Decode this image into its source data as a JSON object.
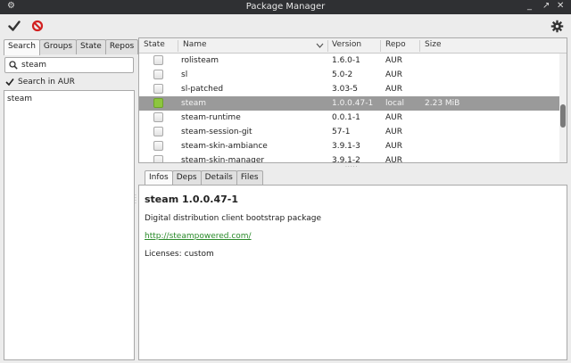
{
  "window": {
    "title": "Package Manager"
  },
  "left": {
    "tabs": [
      {
        "label": "Search",
        "active": true
      },
      {
        "label": "Groups",
        "active": false
      },
      {
        "label": "State",
        "active": false
      },
      {
        "label": "Repos",
        "active": false
      }
    ],
    "search": {
      "value": "steam",
      "placeholder": ""
    },
    "aur_checkbox": {
      "label": "Search in AUR",
      "checked": true
    },
    "results": [
      "steam"
    ]
  },
  "table": {
    "columns": {
      "state": "State",
      "name": "Name",
      "version": "Version",
      "repo": "Repo",
      "size": "Size"
    },
    "rows": [
      {
        "name": "rolisteam",
        "version": "1.6.0-1",
        "repo": "AUR",
        "size": "",
        "installed": false,
        "selected": false
      },
      {
        "name": "sl",
        "version": "5.0-2",
        "repo": "AUR",
        "size": "",
        "installed": false,
        "selected": false
      },
      {
        "name": "sl-patched",
        "version": "3.03-5",
        "repo": "AUR",
        "size": "",
        "installed": false,
        "selected": false
      },
      {
        "name": "steam",
        "version": "1.0.0.47-1",
        "repo": "local",
        "size": "2.23 MiB",
        "installed": true,
        "selected": true
      },
      {
        "name": "steam-runtime",
        "version": "0.0.1-1",
        "repo": "AUR",
        "size": "",
        "installed": false,
        "selected": false
      },
      {
        "name": "steam-session-git",
        "version": "57-1",
        "repo": "AUR",
        "size": "",
        "installed": false,
        "selected": false
      },
      {
        "name": "steam-skin-ambiance",
        "version": "3.9.1-3",
        "repo": "AUR",
        "size": "",
        "installed": false,
        "selected": false
      },
      {
        "name": "steam-skin-manager",
        "version": "3.9.1-2",
        "repo": "AUR",
        "size": "",
        "installed": false,
        "selected": false
      }
    ]
  },
  "details": {
    "tabs": [
      {
        "label": "Infos",
        "active": true
      },
      {
        "label": "Deps",
        "active": false
      },
      {
        "label": "Details",
        "active": false
      },
      {
        "label": "Files",
        "active": false
      }
    ],
    "title": "steam  1.0.0.47-1",
    "description": "Digital distribution client bootstrap package",
    "url": "http://steampowered.com/",
    "licenses_label": "Licenses:",
    "licenses_value": "custom"
  },
  "colors": {
    "installed": "#8dc63f",
    "selection": "#9a9a9a",
    "apply": "#333333",
    "cancel": "#d22020",
    "link": "#2a8a2a"
  }
}
